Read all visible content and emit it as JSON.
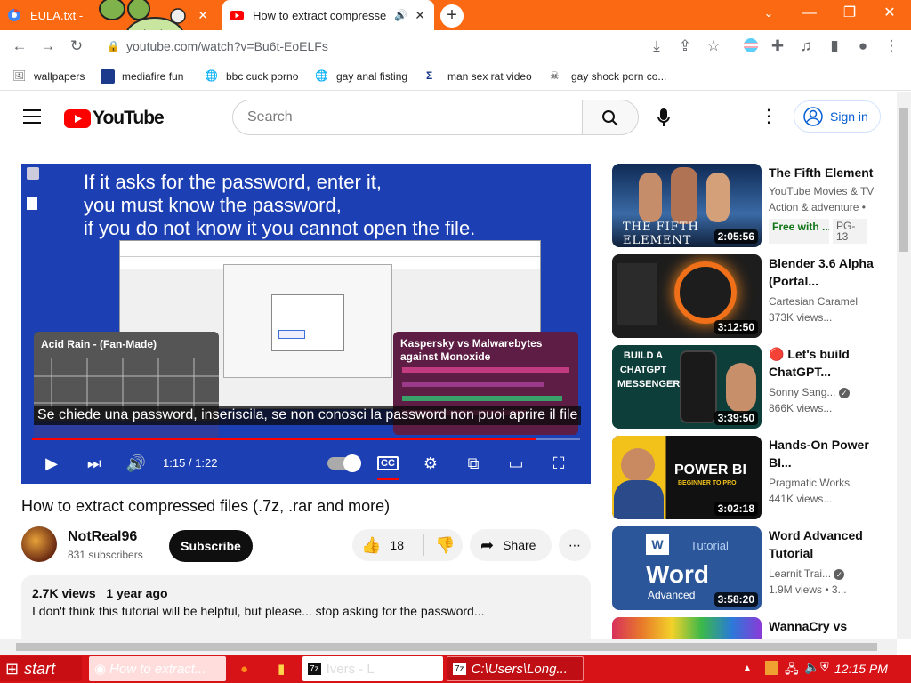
{
  "browser": {
    "tabs": [
      {
        "title": "EULA.txt - ",
        "active": false
      },
      {
        "title": "How to extract compresse",
        "active": true
      }
    ],
    "url": "youtube.com/watch?v=Bu6t-EoELFs",
    "bookmarks": [
      "wallpapers",
      "mediafire fun",
      "bbc cuck porno",
      "gay anal fisting",
      "man sex rat video",
      "gay shock porn co..."
    ]
  },
  "youtube": {
    "logo_text": "YouTube",
    "search_placeholder": "Search",
    "sign_in": "Sign in",
    "player": {
      "overlay_lines": [
        "If it asks for the password, enter it,",
        "you must know the password,",
        "if you do not know it you cannot open the file."
      ],
      "endcards": [
        "Acid Rain - (Fan-Made)",
        "Kaspersky vs Malwarebytes against Monoxide"
      ],
      "subtitle": "Se chiede una password, inseriscila, se non conosci la password non puoi aprire il file",
      "time": "1:15 / 1:22",
      "progress": 0.92
    },
    "video_title": "How to extract compressed files (.7z, .rar and more)",
    "channel": {
      "name": "NotReal96",
      "subscribers": "831 subscribers"
    },
    "subscribe": "Subscribe",
    "likes": "18",
    "share": "Share",
    "description": {
      "views": "2.7K views",
      "age": "1 year ago",
      "text": "I don't think this tutorial will be helpful, but please... stop asking for the password..."
    },
    "recommendations": [
      {
        "title": "The Fifth Element",
        "channel": "YouTube Movies & TV",
        "meta": "Action & adventure •",
        "badge1": "Free with ...",
        "badge2": "PG-13",
        "duration": "2:05:56",
        "thumb_text": "THE FIFTH ELEMENT"
      },
      {
        "title": "Blender 3.6 Alpha (Portal...",
        "channel": "Cartesian Caramel",
        "meta": "373K views...",
        "duration": "3:12:50"
      },
      {
        "title": "🔴 Let's build ChatGPT...",
        "channel": "Sonny Sang...",
        "meta": "866K views...",
        "duration": "3:39:50",
        "thumb_text": "BUILD A CHATGPT MESSENGER"
      },
      {
        "title": "Hands-On Power BI...",
        "channel": "Pragmatic Works",
        "meta": "441K views...",
        "duration": "3:02:18",
        "thumb_text": "POWER BI",
        "thumb_sub": "BEGINNER TO PRO"
      },
      {
        "title": "Word Advanced Tutorial",
        "channel": "Learnit Trai...",
        "meta": "1.9M views • 3...",
        "duration": "3:58:20",
        "thumb_text": "Word",
        "thumb_sub": "Advanced",
        "thumb_top": "Tutorial"
      },
      {
        "title": "WannaCry vs",
        "channel": "",
        "meta": "",
        "duration": ""
      }
    ]
  },
  "taskbar": {
    "start": "start",
    "items": [
      "How to extract...",
      "",
      "",
      "Ivers - L",
      "C:\\Users\\Long..."
    ],
    "clock": "12:15 PM"
  }
}
